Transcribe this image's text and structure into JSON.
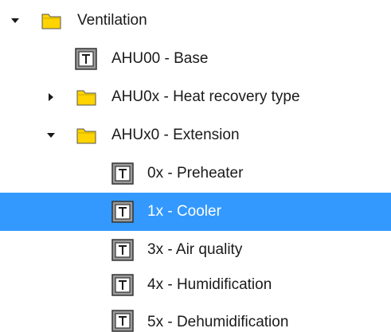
{
  "tree": {
    "nodes": [
      {
        "label": "Ventilation",
        "icon": "folder-icon",
        "toggle": "expanded",
        "selected": false
      },
      {
        "label": "AHU00 - Base",
        "icon": "template-icon",
        "toggle": "none",
        "selected": false
      },
      {
        "label": "AHU0x - Heat recovery type",
        "icon": "folder-icon",
        "toggle": "collapsed",
        "selected": false
      },
      {
        "label": "AHUx0 - Extension",
        "icon": "folder-icon",
        "toggle": "expanded",
        "selected": false
      },
      {
        "label": "0x - Preheater",
        "icon": "template-icon",
        "toggle": "none",
        "selected": false
      },
      {
        "label": "1x - Cooler",
        "icon": "template-icon",
        "toggle": "none",
        "selected": true
      },
      {
        "label": "3x - Air quality",
        "icon": "template-icon",
        "toggle": "none",
        "selected": false
      },
      {
        "label": "4x - Humidification",
        "icon": "template-icon",
        "toggle": "none",
        "selected": false
      },
      {
        "label": "5x - Dehumidification",
        "icon": "template-icon",
        "toggle": "none",
        "selected": false
      }
    ]
  },
  "colors": {
    "selection": "#3399ff",
    "folder": "#ffd700",
    "template_icon": "#808080"
  }
}
